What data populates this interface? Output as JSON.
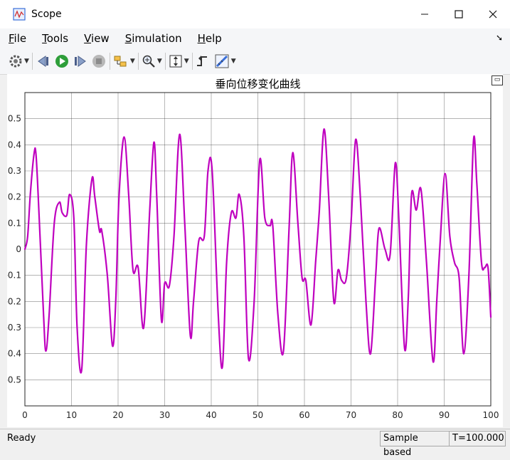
{
  "window": {
    "title": "Scope"
  },
  "menu": [
    {
      "label": "File",
      "accel": "F",
      "rest": "ile"
    },
    {
      "label": "Tools",
      "accel": "T",
      "rest": "ools"
    },
    {
      "label": "View",
      "accel": "V",
      "rest": "iew"
    },
    {
      "label": "Simulation",
      "accel": "S",
      "rest": "imulation"
    },
    {
      "label": "Help",
      "accel": "H",
      "rest": "elp"
    }
  ],
  "toolbar": {
    "icons": [
      "gear-icon",
      "step-back-icon",
      "run-icon",
      "step-forward-icon",
      "stop-icon",
      "signal-selector-icon",
      "zoom-icon",
      "autoscale-icon",
      "triggers-icon",
      "measurements-icon"
    ]
  },
  "status": {
    "left": "Ready",
    "mode": "Sample based",
    "time": "T=100.000"
  },
  "chart_data": {
    "type": "line",
    "title": "垂向位移变化曲线",
    "xlabel": "",
    "ylabel": "",
    "xlim": [
      0,
      100
    ],
    "ylim": [
      -0.6,
      0.6
    ],
    "xticks": [
      0,
      10,
      20,
      30,
      40,
      50,
      60,
      70,
      80,
      90,
      100
    ],
    "yticks": [
      0.5,
      0.4,
      0.3,
      0.2,
      0.1,
      0,
      -0.1,
      -0.2,
      -0.3,
      -0.4,
      -0.5
    ],
    "ytick_labels": [
      "0.5",
      "0.4",
      "0.3",
      "0.2",
      "0.1",
      "0",
      "-0.1",
      "-0.2",
      "-0.3",
      "-0.4",
      "-0.5"
    ],
    "grid": true,
    "line_color": "#bf00bf",
    "series": [
      {
        "x": [
          0,
          0.6,
          1.2,
          2.0,
          2.4,
          3.0,
          4.0,
          4.5,
          5.2,
          6.3,
          7.4,
          8.0,
          9.0,
          9.6,
          10.5,
          11.2,
          12.2,
          13.2,
          14.4,
          15.0,
          16.0,
          16.5,
          17.7,
          18.8,
          19.5,
          20.2,
          21.3,
          22.3,
          23.2,
          24.3,
          25.5,
          26.8,
          27.7,
          28.3,
          29.3,
          30.0,
          31.0,
          32.0,
          33.2,
          34.3,
          35.5,
          36.2,
          37.3,
          38.5,
          39.3,
          40.2,
          41.5,
          42.4,
          43.3,
          44.3,
          45.3,
          46.0,
          47.0,
          48.0,
          49.2,
          50.4,
          51.5,
          52.6,
          53.2,
          54.3,
          55.5,
          56.7,
          57.5,
          58.6,
          59.5,
          60.3,
          61.4,
          62.4,
          63.2,
          64.2,
          65.2,
          66.3,
          67.2,
          68.0,
          69.0,
          70.0,
          71.0,
          72.0,
          73.2,
          74.2,
          75.3,
          76.0,
          77.3,
          78.4,
          79.5,
          80.3,
          81.5,
          82.3,
          83.0,
          84.0,
          85.0,
          86.2,
          87.6,
          88.4,
          89.2,
          90.2,
          91.2,
          92.2,
          93.2,
          94.2,
          95.3,
          96.3,
          97.0,
          98.0,
          98.7,
          99.4,
          100
        ],
        "y": [
          0,
          0.05,
          0.22,
          0.37,
          0.36,
          0.15,
          -0.25,
          -0.39,
          -0.25,
          0.1,
          0.18,
          0.14,
          0.13,
          0.21,
          0.12,
          -0.3,
          -0.46,
          0.02,
          0.27,
          0.2,
          0.07,
          0.07,
          -0.1,
          -0.37,
          -0.2,
          0.2,
          0.43,
          0.2,
          -0.08,
          -0.07,
          -0.3,
          0.15,
          0.41,
          0.2,
          -0.27,
          -0.13,
          -0.14,
          0.05,
          0.44,
          0.1,
          -0.33,
          -0.2,
          0.03,
          0.05,
          0.3,
          0.3,
          -0.25,
          -0.45,
          -0.05,
          0.14,
          0.12,
          0.21,
          0.05,
          -0.42,
          -0.2,
          0.34,
          0.12,
          0.09,
          0.09,
          -0.25,
          -0.39,
          0.08,
          0.37,
          0.1,
          -0.11,
          -0.12,
          -0.29,
          -0.05,
          0.15,
          0.46,
          0.2,
          -0.2,
          -0.08,
          -0.12,
          -0.11,
          0.1,
          0.42,
          0.2,
          -0.2,
          -0.4,
          -0.1,
          0.08,
          0.0,
          -0.02,
          0.33,
          0.1,
          -0.38,
          -0.18,
          0.21,
          0.15,
          0.23,
          -0.05,
          -0.43,
          -0.2,
          0.05,
          0.29,
          0.05,
          -0.05,
          -0.11,
          -0.4,
          -0.1,
          0.42,
          0.25,
          -0.05,
          -0.07,
          -0.07,
          -0.26
        ]
      }
    ]
  }
}
